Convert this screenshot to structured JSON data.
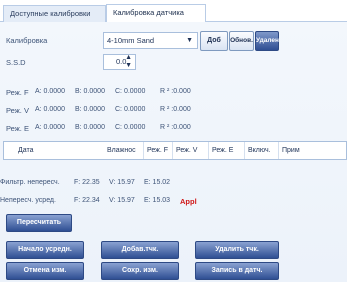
{
  "tabs": [
    {
      "label": "Доступные калибровки",
      "active": false
    },
    {
      "label": "Калибровка датчика",
      "active": true
    }
  ],
  "calibration": {
    "label": "Калибровка",
    "selected": "4-10mm Sand",
    "add_label": "Доб",
    "update_label": "Обнов.",
    "delete_label": "Удален"
  },
  "ssd": {
    "label": "S.S.D",
    "value": "0.0"
  },
  "modes": [
    {
      "label": "Реж. F",
      "a": "A: 0.0000",
      "b": "B: 0.0000",
      "c": "C: 0.0000",
      "r2": "R ² :0.000"
    },
    {
      "label": "Реж. V",
      "a": "A: 0.0000",
      "b": "B: 0.0000",
      "c": "C: 0.0000",
      "r2": "R ² :0.000"
    },
    {
      "label": "Реж. E",
      "a": "A: 0.0000",
      "b": "B: 0.0000",
      "c": "C: 0.0000",
      "r2": "R ² :0.000"
    }
  ],
  "table": {
    "columns": [
      "Дата",
      "Влажнос",
      "Реж. F",
      "Реж. V",
      "Реж. E",
      "Включ.",
      "Прим"
    ]
  },
  "filtered": {
    "label": "Фильтр. непересч.",
    "f": "F: 22.35",
    "v": "V: 15.97",
    "e": "E: 15.02"
  },
  "unaveraged": {
    "label": "Непересч. усред.",
    "f": "F: 22.34",
    "v": "V: 15.97",
    "e": "E: 15.03",
    "appl": "Appl"
  },
  "buttons": {
    "recalc": "Пересчитать",
    "start_avg": "Начало усредн.",
    "add_point": "Добав.тчк.",
    "delete_point": "Удалить тчк.",
    "cancel": "Отмена изм.",
    "save": "Сохр. изм.",
    "write": "Запись в датч."
  },
  "colors": {
    "button_dark": "#2f4f93",
    "accent_red": "#d01818",
    "panel": "#eef3fa"
  }
}
